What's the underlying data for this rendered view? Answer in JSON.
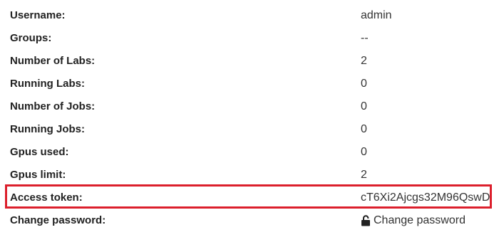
{
  "profile": {
    "rows": [
      {
        "label": "Username:",
        "value": "admin"
      },
      {
        "label": "Groups:",
        "value": "--"
      },
      {
        "label": "Number of Labs:",
        "value": "2"
      },
      {
        "label": "Running Labs:",
        "value": "0"
      },
      {
        "label": "Number of Jobs:",
        "value": "0"
      },
      {
        "label": "Running Jobs:",
        "value": "0"
      },
      {
        "label": "Gpus used:",
        "value": "0"
      },
      {
        "label": "Gpus limit:",
        "value": "2"
      },
      {
        "label": "Access token:",
        "value": "cT6Xi2Ajcgs32M96QswD"
      },
      {
        "label": "Change password:",
        "link_text": "Change password",
        "icon": "unlock-icon"
      }
    ]
  },
  "colors": {
    "highlight": "#dc1f2c",
    "label_text": "#222222",
    "value_text": "#333333"
  }
}
